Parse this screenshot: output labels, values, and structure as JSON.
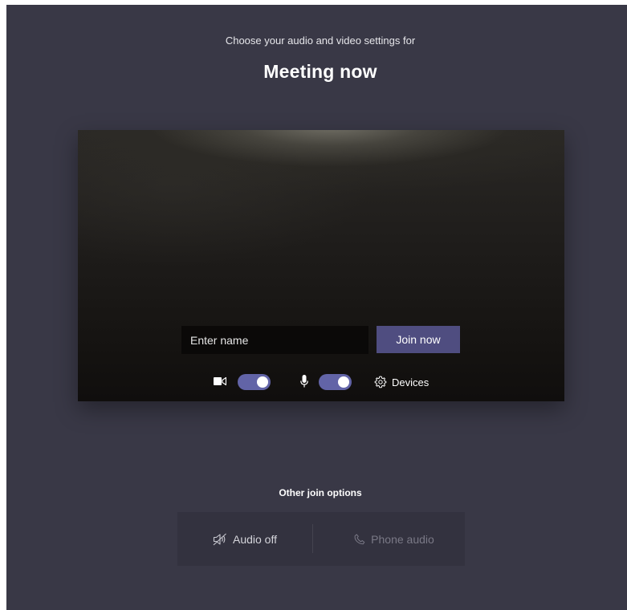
{
  "header": {
    "subtitle": "Choose your audio and video settings for",
    "title": "Meeting now"
  },
  "preview": {
    "name_placeholder": "Enter name",
    "join_label": "Join now",
    "camera_on": true,
    "mic_on": true,
    "devices_label": "Devices"
  },
  "other": {
    "title": "Other join options",
    "audio_off_label": "Audio off",
    "phone_audio_label": "Phone audio"
  },
  "colors": {
    "background": "#393846",
    "accent": "#6264a7",
    "join_button": "#4f4d80"
  },
  "icons": {
    "camera": "video-camera-icon",
    "mic": "microphone-icon",
    "devices": "gear-icon",
    "audio_off": "speaker-off-icon",
    "phone": "phone-icon"
  }
}
